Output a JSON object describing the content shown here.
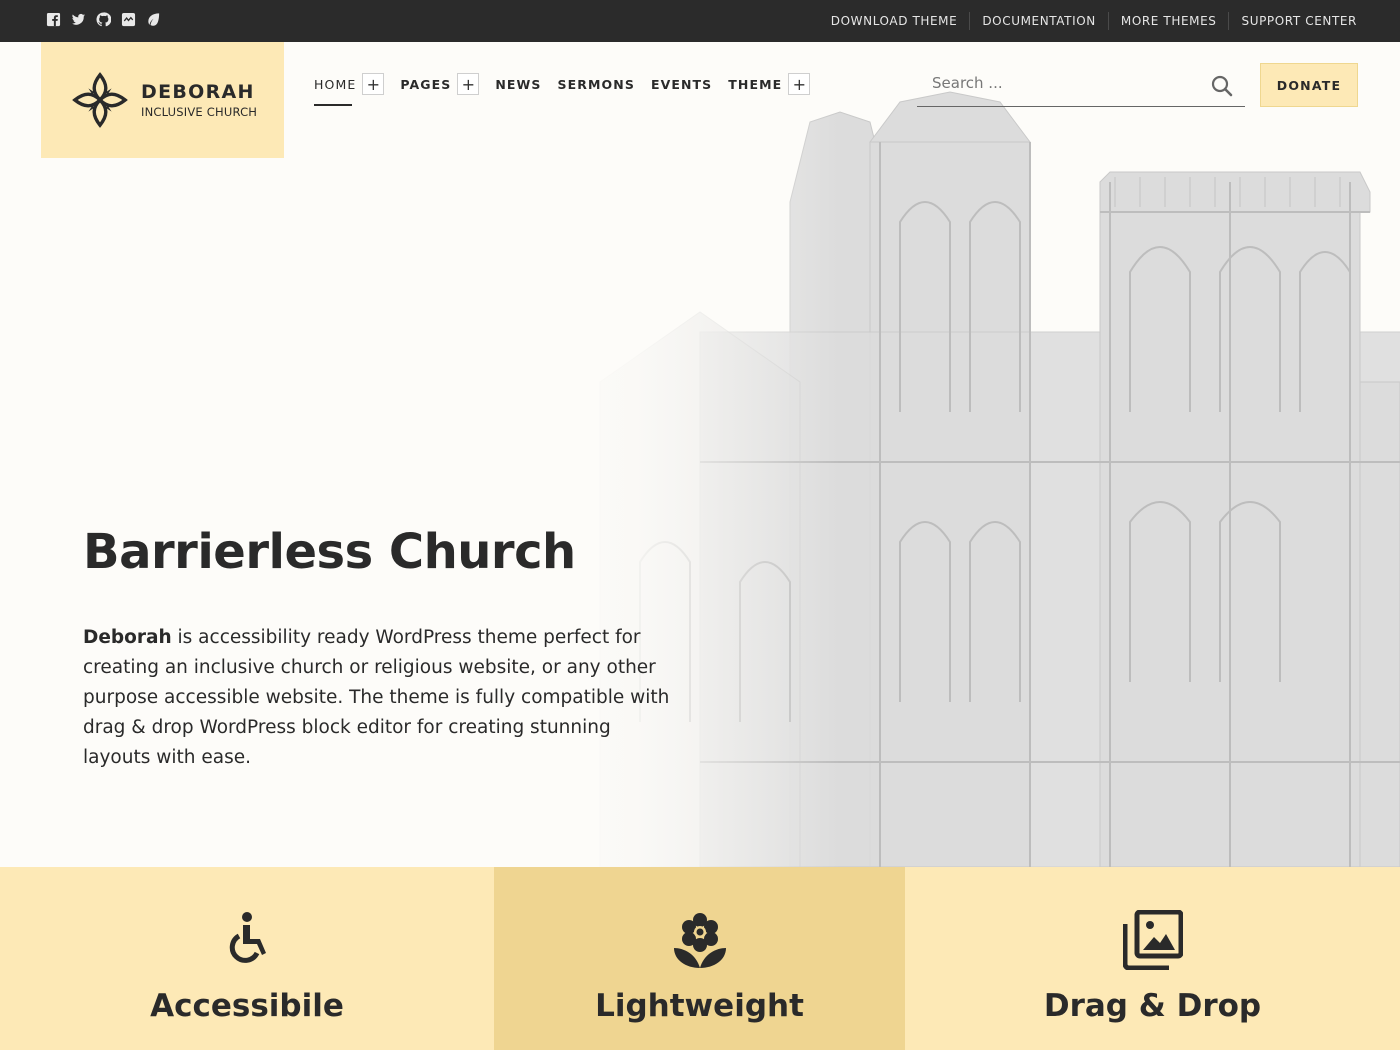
{
  "topbar": {
    "social_icons": [
      "facebook-icon",
      "twitter-icon",
      "github-icon",
      "codepen-icon",
      "leaf-icon"
    ],
    "links": [
      "DOWNLOAD THEME",
      "DOCUMENTATION",
      "MORE THEMES",
      "SUPPORT CENTER"
    ]
  },
  "header": {
    "logo_name": "DEBORAH",
    "logo_tagline": "INCLUSIVE CHURCH",
    "nav": [
      {
        "label": "HOME",
        "has_submenu": true,
        "active": true
      },
      {
        "label": "PAGES",
        "has_submenu": true
      },
      {
        "label": "NEWS",
        "has_submenu": false
      },
      {
        "label": "SERMONS",
        "has_submenu": false
      },
      {
        "label": "EVENTS",
        "has_submenu": false
      },
      {
        "label": "THEME",
        "has_submenu": true
      }
    ],
    "submenu_toggle": "+",
    "search_placeholder": "Search ...",
    "donate_label": "DONATE"
  },
  "hero": {
    "title": "Barrierless Church",
    "desc_bold": "Deborah",
    "desc_rest": " is accessibility ready WordPress theme perfect for creating an inclusive church or religious website, or any other purpose accessible website. The theme is fully compatible with drag & drop WordPress block editor for creating stunning layouts with ease."
  },
  "features": [
    {
      "title": "Accessibile",
      "icon": "wheelchair-icon"
    },
    {
      "title": "Lightweight",
      "icon": "flower-icon"
    },
    {
      "title": "Drag & Drop",
      "icon": "images-icon"
    }
  ],
  "colors": {
    "topbar": "#2b2b2b",
    "accent_light": "#fde9b6",
    "accent_mid": "#efd591",
    "text": "#2a2a2a"
  }
}
